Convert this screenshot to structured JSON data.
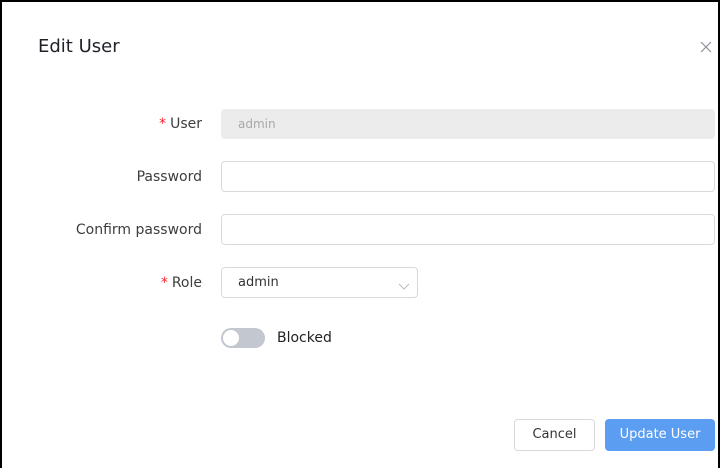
{
  "dialog": {
    "title": "Edit User"
  },
  "form": {
    "required_mark": "*",
    "user": {
      "label": "User",
      "value": "admin",
      "disabled": true
    },
    "password": {
      "label": "Password",
      "value": ""
    },
    "confirm_password": {
      "label": "Confirm password",
      "value": ""
    },
    "role": {
      "label": "Role",
      "selected": "admin"
    },
    "blocked": {
      "label": "Blocked",
      "on": false
    }
  },
  "footer": {
    "cancel_label": "Cancel",
    "submit_label": "Update User"
  },
  "colors": {
    "primary": "#5b9df0",
    "required": "#f5222d",
    "switch_off": "#c2c7d0",
    "disabled_bg": "#ececec"
  },
  "icons": {
    "close": "close-icon",
    "select_arrow": "chevron-down-icon"
  }
}
